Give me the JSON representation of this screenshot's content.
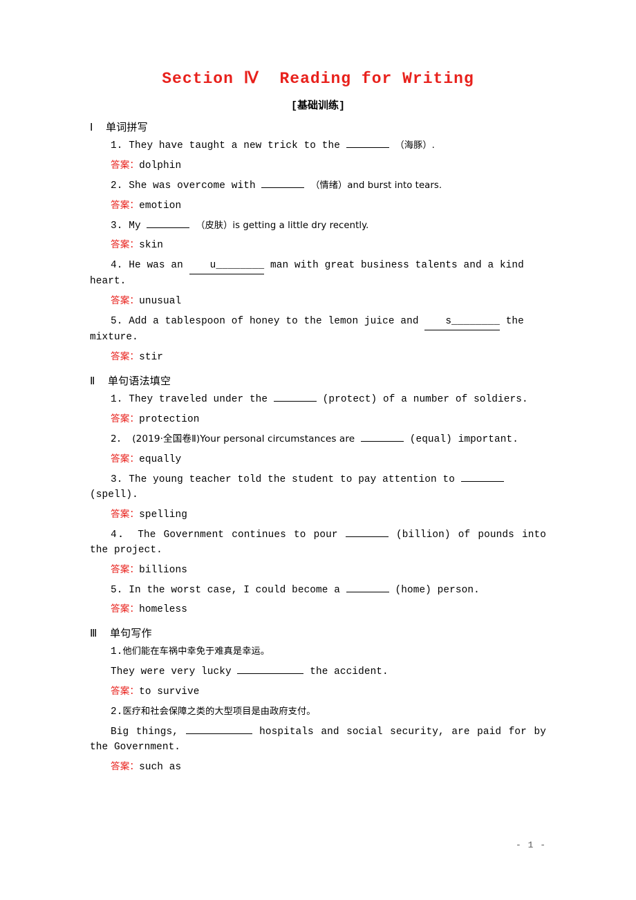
{
  "document": {
    "title": "Section Ⅳ  Reading for Writing",
    "subtitle": "[基础训练]",
    "page_number": "- 1 -",
    "answer_label": "答案：",
    "title_color": "#e8211c",
    "answer_label_color": "#e8211c"
  },
  "parts": [
    {
      "heading": "Ⅰ  单词拼写",
      "items": [
        {
          "number": "1.",
          "pre": "They have taught a new trick to the",
          "blank": "________",
          "post": "（海豚）.",
          "answer": "dolphin"
        },
        {
          "number": "2.",
          "pre": "She was overcome with",
          "blank": "________",
          "post": "（情绪）and burst into tears.",
          "answer": "emotion"
        },
        {
          "number": "3.",
          "pre": "My",
          "blank": "________",
          "post": "（皮肤）is getting a little dry recently.",
          "answer": "skin"
        },
        {
          "number": "4.",
          "pre": "He was an",
          "blank": "u________",
          "post": "man with great business talents and a kind heart.",
          "answer": "unusual"
        },
        {
          "number": "5.",
          "pre": "Add a tablespoon of honey to the lemon juice and",
          "blank": "s________",
          "post": "the mixture.",
          "answer": "stir"
        }
      ]
    },
    {
      "heading": "Ⅱ  单句语法填空",
      "items": [
        {
          "number": "1.",
          "pre": "They traveled under the",
          "blank": "________",
          "post": "(protect) of a number of soldiers.",
          "answer": "protection"
        },
        {
          "number": "2．",
          "pre": "(2019·全国卷Ⅱ)Your personal circumstances are",
          "blank": "________",
          "post": "(equal) important.",
          "answer": "equally"
        },
        {
          "number": "3.",
          "pre": "The young teacher told the student to pay attention to",
          "blank": "________",
          "post": "(spell).",
          "answer": "spelling"
        },
        {
          "number": "4．",
          "pre": "The Government continues to pour",
          "blank": "________",
          "post": "(billion) of pounds into the project.",
          "answer": "billions"
        },
        {
          "number": "5.",
          "pre": "In the worst case, I could become a",
          "blank": "________",
          "post": "(home) person.",
          "answer": "homeless"
        }
      ]
    },
    {
      "heading": "Ⅲ  单句写作",
      "items": [
        {
          "number": "1.",
          "chinese": "他们能在车祸中幸免于难真是幸运。",
          "pre": "They were very lucky",
          "blank": "____________",
          "post": "the accident.",
          "answer": "to survive"
        },
        {
          "number": "2.",
          "chinese": "医疗和社会保障之类的大型项目是由政府支付。",
          "pre": "Big things,",
          "blank": "____________",
          "post": "hospitals and social security, are paid for by the Government.",
          "answer": "such as"
        }
      ]
    }
  ]
}
